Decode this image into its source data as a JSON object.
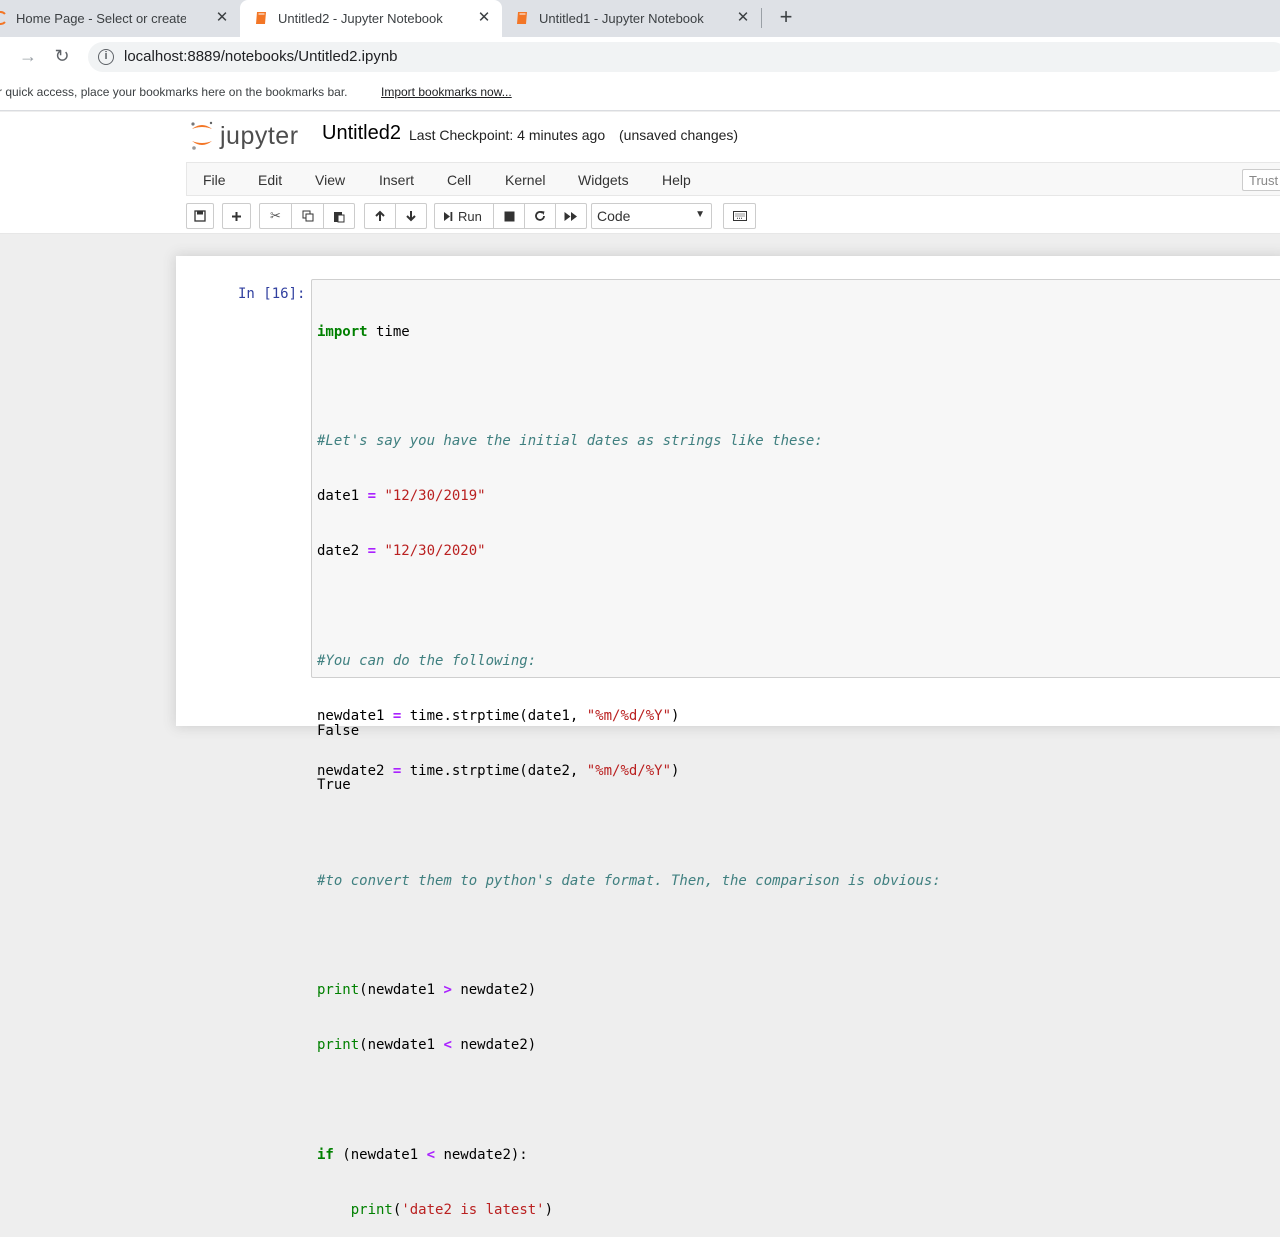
{
  "browser": {
    "tabs": [
      {
        "title": "Home Page - Select or create a n",
        "active": false
      },
      {
        "title": "Untitled2 - Jupyter Notebook",
        "active": true
      },
      {
        "title": "Untitled1 - Jupyter Notebook",
        "active": false
      }
    ],
    "close_glyph": "✕",
    "new_tab_glyph": "+",
    "url": "localhost:8889/notebooks/Untitled2.ipynb",
    "bookmarks_message": "r quick access, place your bookmarks here on the bookmarks bar.",
    "import_bookmarks": "Import bookmarks now..."
  },
  "jupyter": {
    "logo_text": "jupyter",
    "notebook_title": "Untitled2",
    "checkpoint": "Last Checkpoint: 4 minutes ago",
    "unsaved": "(unsaved changes)",
    "menu": [
      "File",
      "Edit",
      "View",
      "Insert",
      "Cell",
      "Kernel",
      "Widgets",
      "Help"
    ],
    "trusted_label": "Trust",
    "toolbar": {
      "run_label": "Run",
      "cell_type": "Code"
    },
    "accent_color": "#f37626"
  },
  "cell": {
    "prompt": "In [16]:",
    "code_lines": [
      "import time",
      "",
      "#Let's say you have the initial dates as strings like these:",
      "date1 = \"12/30/2019\"",
      "date2 = \"12/30/2020\"",
      "",
      "#You can do the following:",
      "newdate1 = time.strptime(date1, \"%m/%d/%Y\")",
      "newdate2 = time.strptime(date2, \"%m/%d/%Y\")",
      "",
      "#to convert them to python's date format. Then, the comparison is obvious:",
      "",
      "print(newdate1 > newdate2)",
      "print(newdate1 < newdate2)",
      "",
      "if (newdate1 < newdate2):",
      "    print('date2 is latest')"
    ],
    "output_lines": [
      "False",
      "True"
    ]
  }
}
